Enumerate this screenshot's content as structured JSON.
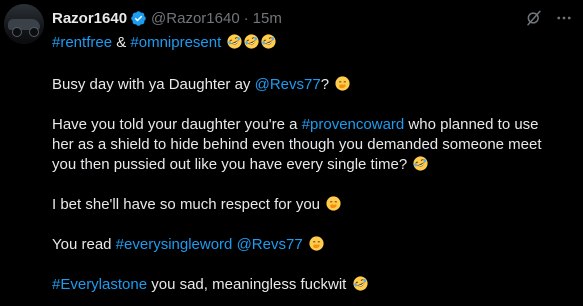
{
  "author": {
    "display_name": "Razor1640",
    "handle": "@Razor1640",
    "separator": "·",
    "time": "15m"
  },
  "lines": [
    {
      "segments": [
        {
          "t": "#rentfree",
          "link": true
        },
        {
          "t": " & ",
          "link": false
        },
        {
          "t": "#omnipresent",
          "link": true
        },
        {
          "t": " ",
          "link": false
        },
        {
          "emoji": "rofl"
        },
        {
          "emoji": "rofl"
        },
        {
          "emoji": "rofl"
        }
      ]
    },
    {
      "segments": [
        {
          "t": "Busy day with ya Daughter ay ",
          "link": false
        },
        {
          "t": "@Revs77",
          "link": true
        },
        {
          "t": "? ",
          "link": false
        },
        {
          "emoji": "hand-over-mouth"
        }
      ]
    },
    {
      "segments": [
        {
          "t": "Have you told your daughter you're a ",
          "link": false
        },
        {
          "t": "#provencoward",
          "link": true
        },
        {
          "t": " who planned to use",
          "link": false
        }
      ]
    },
    {
      "segments": [
        {
          "t": "her as a shield to hide behind even though you demanded someone meet",
          "link": false
        }
      ]
    },
    {
      "segments": [
        {
          "t": "you then pussied out like you have every single time? ",
          "link": false
        },
        {
          "emoji": "rofl"
        }
      ]
    },
    {
      "segments": [
        {
          "t": "I bet she'll have so much respect for you ",
          "link": false
        },
        {
          "emoji": "hand-over-mouth"
        }
      ]
    },
    {
      "segments": [
        {
          "t": "You read ",
          "link": false
        },
        {
          "t": "#everysingleword",
          "link": true
        },
        {
          "t": " ",
          "link": false
        },
        {
          "t": "@Revs77",
          "link": true
        },
        {
          "t": " ",
          "link": false
        },
        {
          "emoji": "hand-over-mouth"
        }
      ]
    },
    {
      "segments": [
        {
          "t": "#Everylastone",
          "link": true
        },
        {
          "t": " you sad, meaningless fuckwit ",
          "link": false
        },
        {
          "emoji": "rofl"
        }
      ]
    }
  ],
  "colors": {
    "background": "#000000",
    "text": "#e7e9ea",
    "muted": "#71767b",
    "link": "#1d9bf0",
    "verified": "#1d9bf0",
    "emoji": "#ffcc4d"
  },
  "icons": {
    "verified": "verified-badge-icon",
    "grok": "grok-icon",
    "menu": "more-icon"
  }
}
